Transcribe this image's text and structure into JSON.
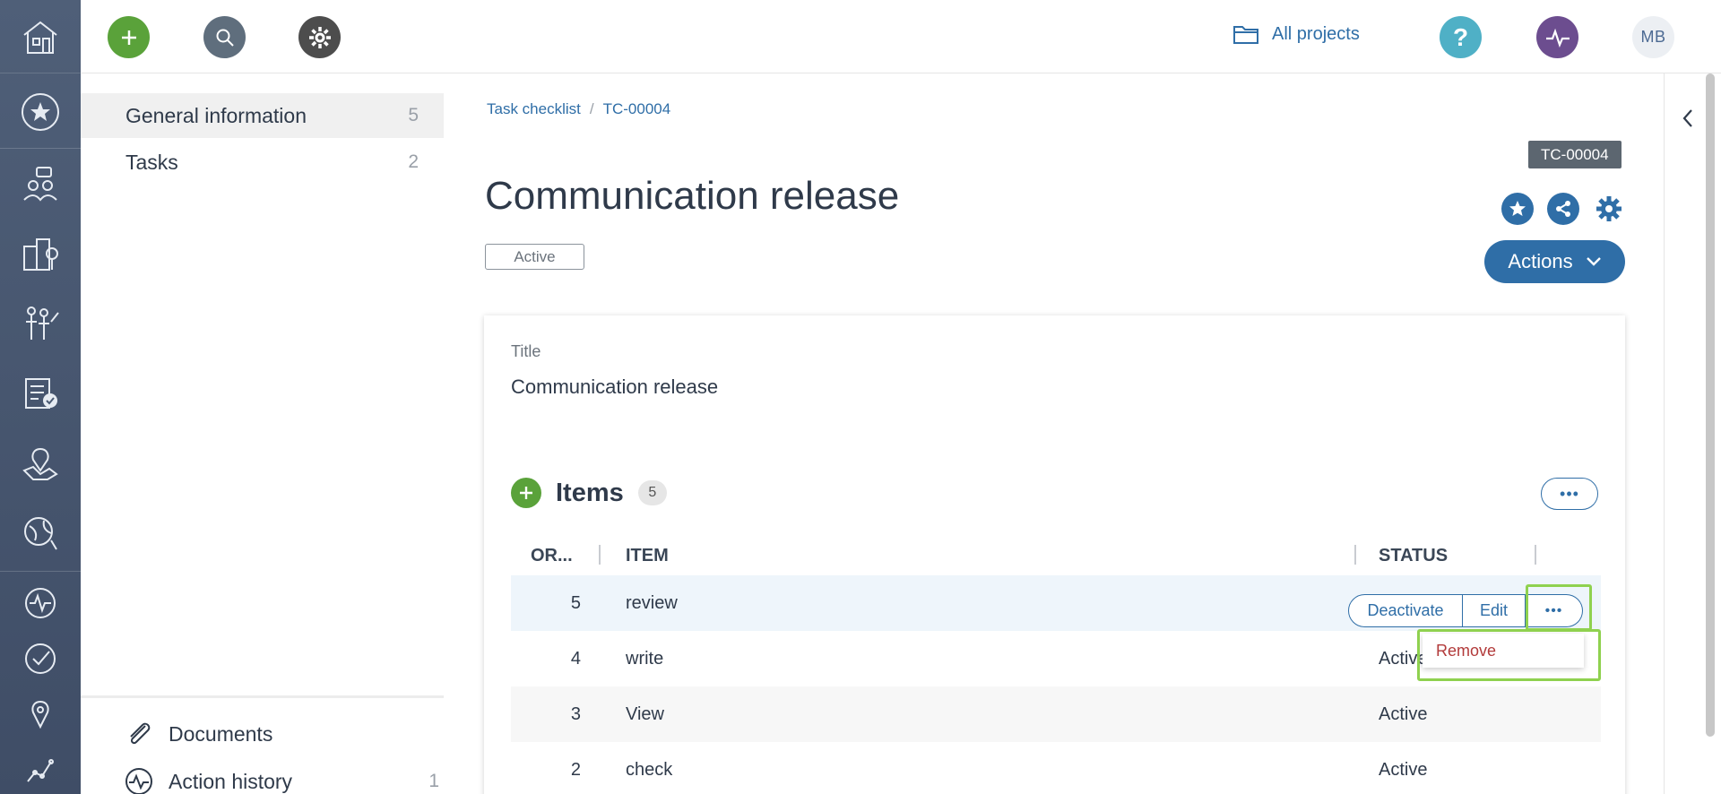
{
  "topbar": {
    "projects_label": "All projects",
    "avatar_initials": "MB",
    "add_color": "#5aa23a",
    "search_color": "#5f6e7d",
    "settings_color": "#4d4d4d",
    "help_color": "#4fb0c6",
    "activity_color": "#6c4d8f"
  },
  "subnav": {
    "items": [
      {
        "label": "General information",
        "count": "5"
      },
      {
        "label": "Tasks",
        "count": "2"
      }
    ],
    "bottom": [
      {
        "label": "Documents",
        "count": ""
      },
      {
        "label": "Action history",
        "count": "1"
      }
    ]
  },
  "breadcrumb": {
    "root": "Task checklist",
    "separator": "/",
    "current": "TC-00004"
  },
  "header": {
    "code_badge": "TC-00004",
    "title": "Communication release",
    "status": "Active",
    "actions_label": "Actions"
  },
  "card": {
    "field_label": "Title",
    "field_value": "Communication release",
    "items_title": "Items",
    "items_count": "5",
    "more_label": "•••",
    "columns": {
      "order": "OR...",
      "item": "ITEM",
      "status": "STATUS"
    },
    "rows": [
      {
        "order": "5",
        "item": "review",
        "status": ""
      },
      {
        "order": "4",
        "item": "write",
        "status": "Active"
      },
      {
        "order": "3",
        "item": "View",
        "status": "Active"
      },
      {
        "order": "2",
        "item": "check",
        "status": "Active"
      }
    ],
    "row_actions": {
      "deactivate": "Deactivate",
      "edit": "Edit",
      "more": "•••"
    },
    "dropdown": {
      "remove": "Remove"
    }
  }
}
